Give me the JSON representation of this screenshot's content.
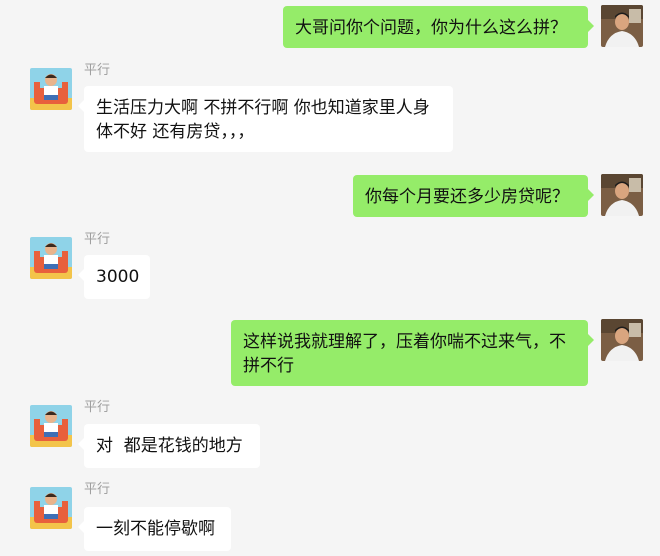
{
  "contacts": {
    "other": {
      "name": "平行"
    }
  },
  "messages": [
    {
      "side": "right",
      "text": "大哥问你个问题，你为什么这么拼？"
    },
    {
      "side": "left",
      "name": "平行",
      "text": "生活压力大啊 不拼不行啊 你也知道家里人身体不好 还有房贷，，，"
    },
    {
      "side": "right",
      "text": "你每个月要还多少房贷呢？"
    },
    {
      "side": "left",
      "name": "平行",
      "text": "3000"
    },
    {
      "side": "right",
      "text": "这样说我就理解了，压着你喘不过来气，不拼不行"
    },
    {
      "side": "left",
      "name": "平行",
      "text": "对  都是花钱的地方"
    },
    {
      "side": "left",
      "name": "平行",
      "text": "一刻不能停歇啊"
    }
  ],
  "colors": {
    "background": "#f5f5f5",
    "outgoing_bubble": "#95ec69",
    "incoming_bubble": "#ffffff",
    "name_text": "#9e9e9e"
  }
}
